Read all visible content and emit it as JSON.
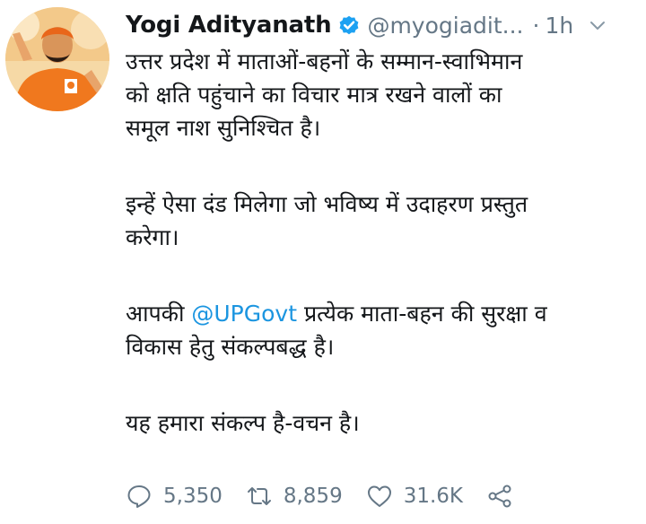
{
  "user": {
    "display_name": "Yogi Adityanath",
    "handle": "@myogiadit...",
    "separator": "·",
    "time": "1h"
  },
  "icons": {
    "verified": "verified-badge-icon",
    "caret": "chevron-down-icon",
    "reply": "reply-icon",
    "retweet": "retweet-icon",
    "like": "heart-icon",
    "share": "share-icon"
  },
  "colors": {
    "link": "#1b95e0",
    "verified": "#1da1f2",
    "muted": "#657786",
    "avatar_robe": "#f0781e"
  },
  "tweet": {
    "p1": {
      "line1": "उत्तर प्रदेश में माताओं-बहनों के सम्मान-स्वाभिमान",
      "line2": "को क्षति पहुंचाने का विचार मात्र रखने वालों का",
      "line3": "समूल नाश सुनिश्चित है।"
    },
    "p2": {
      "line1": "इन्हें ऐसा दंड मिलेगा जो भविष्य में उदाहरण प्रस्तुत",
      "line2": "करेगा।"
    },
    "p3": {
      "line1_before": "आपकी ",
      "mention": "@UPGovt",
      "line1_after": " प्रत्येक माता-बहन की सुरक्षा व",
      "line2": "विकास हेतु संकल्पबद्ध है।"
    },
    "p4": {
      "line1": "यह हमारा संकल्प है-वचन है।"
    }
  },
  "actions": {
    "replies": "5,350",
    "retweets": "8,859",
    "likes": "31.6K"
  }
}
